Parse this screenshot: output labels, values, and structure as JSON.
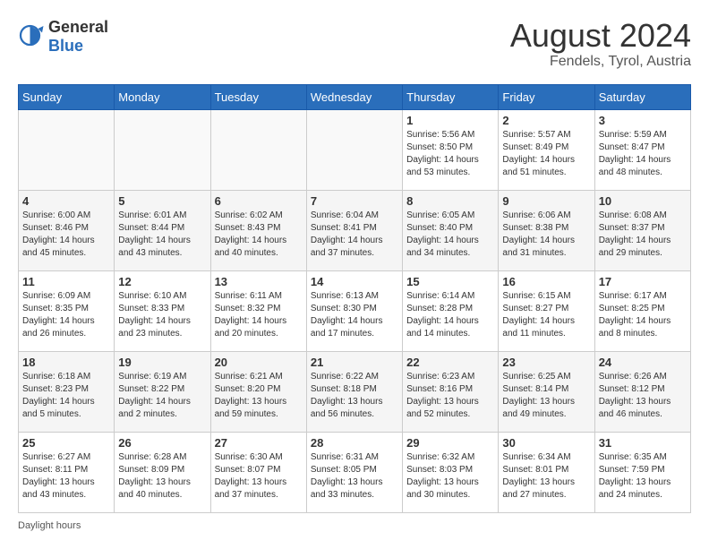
{
  "header": {
    "logo_general": "General",
    "logo_blue": "Blue",
    "month_title": "August 2024",
    "location": "Fendels, Tyrol, Austria"
  },
  "days_of_week": [
    "Sunday",
    "Monday",
    "Tuesday",
    "Wednesday",
    "Thursday",
    "Friday",
    "Saturday"
  ],
  "weeks": [
    [
      {
        "day": "",
        "info": ""
      },
      {
        "day": "",
        "info": ""
      },
      {
        "day": "",
        "info": ""
      },
      {
        "day": "",
        "info": ""
      },
      {
        "day": "1",
        "info": "Sunrise: 5:56 AM\nSunset: 8:50 PM\nDaylight: 14 hours\nand 53 minutes."
      },
      {
        "day": "2",
        "info": "Sunrise: 5:57 AM\nSunset: 8:49 PM\nDaylight: 14 hours\nand 51 minutes."
      },
      {
        "day": "3",
        "info": "Sunrise: 5:59 AM\nSunset: 8:47 PM\nDaylight: 14 hours\nand 48 minutes."
      }
    ],
    [
      {
        "day": "4",
        "info": "Sunrise: 6:00 AM\nSunset: 8:46 PM\nDaylight: 14 hours\nand 45 minutes."
      },
      {
        "day": "5",
        "info": "Sunrise: 6:01 AM\nSunset: 8:44 PM\nDaylight: 14 hours\nand 43 minutes."
      },
      {
        "day": "6",
        "info": "Sunrise: 6:02 AM\nSunset: 8:43 PM\nDaylight: 14 hours\nand 40 minutes."
      },
      {
        "day": "7",
        "info": "Sunrise: 6:04 AM\nSunset: 8:41 PM\nDaylight: 14 hours\nand 37 minutes."
      },
      {
        "day": "8",
        "info": "Sunrise: 6:05 AM\nSunset: 8:40 PM\nDaylight: 14 hours\nand 34 minutes."
      },
      {
        "day": "9",
        "info": "Sunrise: 6:06 AM\nSunset: 8:38 PM\nDaylight: 14 hours\nand 31 minutes."
      },
      {
        "day": "10",
        "info": "Sunrise: 6:08 AM\nSunset: 8:37 PM\nDaylight: 14 hours\nand 29 minutes."
      }
    ],
    [
      {
        "day": "11",
        "info": "Sunrise: 6:09 AM\nSunset: 8:35 PM\nDaylight: 14 hours\nand 26 minutes."
      },
      {
        "day": "12",
        "info": "Sunrise: 6:10 AM\nSunset: 8:33 PM\nDaylight: 14 hours\nand 23 minutes."
      },
      {
        "day": "13",
        "info": "Sunrise: 6:11 AM\nSunset: 8:32 PM\nDaylight: 14 hours\nand 20 minutes."
      },
      {
        "day": "14",
        "info": "Sunrise: 6:13 AM\nSunset: 8:30 PM\nDaylight: 14 hours\nand 17 minutes."
      },
      {
        "day": "15",
        "info": "Sunrise: 6:14 AM\nSunset: 8:28 PM\nDaylight: 14 hours\nand 14 minutes."
      },
      {
        "day": "16",
        "info": "Sunrise: 6:15 AM\nSunset: 8:27 PM\nDaylight: 14 hours\nand 11 minutes."
      },
      {
        "day": "17",
        "info": "Sunrise: 6:17 AM\nSunset: 8:25 PM\nDaylight: 14 hours\nand 8 minutes."
      }
    ],
    [
      {
        "day": "18",
        "info": "Sunrise: 6:18 AM\nSunset: 8:23 PM\nDaylight: 14 hours\nand 5 minutes."
      },
      {
        "day": "19",
        "info": "Sunrise: 6:19 AM\nSunset: 8:22 PM\nDaylight: 14 hours\nand 2 minutes."
      },
      {
        "day": "20",
        "info": "Sunrise: 6:21 AM\nSunset: 8:20 PM\nDaylight: 13 hours\nand 59 minutes."
      },
      {
        "day": "21",
        "info": "Sunrise: 6:22 AM\nSunset: 8:18 PM\nDaylight: 13 hours\nand 56 minutes."
      },
      {
        "day": "22",
        "info": "Sunrise: 6:23 AM\nSunset: 8:16 PM\nDaylight: 13 hours\nand 52 minutes."
      },
      {
        "day": "23",
        "info": "Sunrise: 6:25 AM\nSunset: 8:14 PM\nDaylight: 13 hours\nand 49 minutes."
      },
      {
        "day": "24",
        "info": "Sunrise: 6:26 AM\nSunset: 8:12 PM\nDaylight: 13 hours\nand 46 minutes."
      }
    ],
    [
      {
        "day": "25",
        "info": "Sunrise: 6:27 AM\nSunset: 8:11 PM\nDaylight: 13 hours\nand 43 minutes."
      },
      {
        "day": "26",
        "info": "Sunrise: 6:28 AM\nSunset: 8:09 PM\nDaylight: 13 hours\nand 40 minutes."
      },
      {
        "day": "27",
        "info": "Sunrise: 6:30 AM\nSunset: 8:07 PM\nDaylight: 13 hours\nand 37 minutes."
      },
      {
        "day": "28",
        "info": "Sunrise: 6:31 AM\nSunset: 8:05 PM\nDaylight: 13 hours\nand 33 minutes."
      },
      {
        "day": "29",
        "info": "Sunrise: 6:32 AM\nSunset: 8:03 PM\nDaylight: 13 hours\nand 30 minutes."
      },
      {
        "day": "30",
        "info": "Sunrise: 6:34 AM\nSunset: 8:01 PM\nDaylight: 13 hours\nand 27 minutes."
      },
      {
        "day": "31",
        "info": "Sunrise: 6:35 AM\nSunset: 7:59 PM\nDaylight: 13 hours\nand 24 minutes."
      }
    ]
  ],
  "footer": {
    "note": "Daylight hours"
  }
}
